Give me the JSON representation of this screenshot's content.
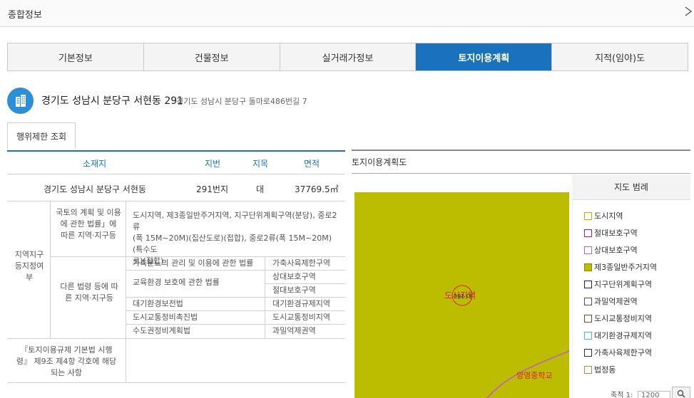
{
  "window": {
    "title": "종합정보"
  },
  "tabs": [
    {
      "label": "기본정보"
    },
    {
      "label": "건물정보"
    },
    {
      "label": "실거래가정보"
    },
    {
      "label": "토지이용계획"
    },
    {
      "label": "지적(임야)도"
    }
  ],
  "active_tab": "토지이용계획",
  "address": {
    "lot": "경기도 성남시 분당구 서현동 291",
    "road": "경기도 성남시 분당구 돌마로486번길 7"
  },
  "restrict_button": "행위제한 조회",
  "table": {
    "headers": {
      "location": "소재지",
      "lot_no": "지번",
      "category": "지목",
      "area": "면적"
    },
    "row": {
      "location": "경기도 성남시 분당구 서현동",
      "lot_no": "291번지",
      "category": "대",
      "area": "37769.5㎡"
    },
    "zone_label": "지역지구등지정여부",
    "national_label": "국토의 계획 및 이용에 관한 법률」에 따른 지역·지구등",
    "national_lines": [
      "도시지역, 제3종일반주거지역, 지구단위계획구역(분당), 중로2류",
      "(폭 15M~20M)(집산도로)(접합), 중로2류(폭 15M~20M)(특수도",
      "로)(접합)"
    ],
    "other_label": "다른 법령 등에 따른 지역·지구등",
    "other_rows": [
      {
        "law": "가축분뇨의 관리 및 이용에 관한 법률",
        "zone": "가축사육제한구역"
      },
      {
        "law": "교육환경 보호에 관한 법률",
        "zone": "상대보호구역"
      },
      {
        "law": "",
        "zone": "절대보호구역"
      },
      {
        "law": "대기환경보전법",
        "zone": "대기환경규제지역"
      },
      {
        "law": "도시교통정비촉진법",
        "zone": "도시교통정비지역"
      },
      {
        "law": "수도권정비계획법",
        "zone": "과밀억제권역"
      }
    ],
    "foot_label": "『토지이용규제 기본법 시행령』 제9조 제4항 각호에 해당되는 사항"
  },
  "map": {
    "title": "토지이용계획도",
    "parcel_label": "291 대",
    "zone_text": "도시지역",
    "school_label": "양영중학교",
    "fill_color": "#bdbd00"
  },
  "legend": {
    "title": "지도 범례",
    "items": [
      {
        "label": "도시지역",
        "border": "#b8b800",
        "fill": "#ffffff"
      },
      {
        "label": "절대보호구역",
        "border": "#a0208a",
        "fill": "#ffffff"
      },
      {
        "label": "상대보호구역",
        "border": "#c060c0",
        "fill": "#ffffff"
      },
      {
        "label": "제3종일반주거지역",
        "border": "#8a8a00",
        "fill": "#bdbd00"
      },
      {
        "label": "지구단위계획구역",
        "border": "#1a1a8a",
        "fill": "#ffffff"
      },
      {
        "label": "과밀억제권역",
        "border": "#555555",
        "fill": "#ffffff"
      },
      {
        "label": "도시교통정비지역",
        "border": "#7a4a3a",
        "fill": "#ffffff"
      },
      {
        "label": "대기환경규제지역",
        "border": "#40c0d0",
        "fill": "#ffffff"
      },
      {
        "label": "가축사육제한구역",
        "border": "#333333",
        "fill": "#ffffff"
      },
      {
        "label": "법정동",
        "border": "#a09060",
        "fill": "#ffffff"
      }
    ]
  },
  "scale": {
    "label": "축적 1:",
    "value": "1200"
  }
}
